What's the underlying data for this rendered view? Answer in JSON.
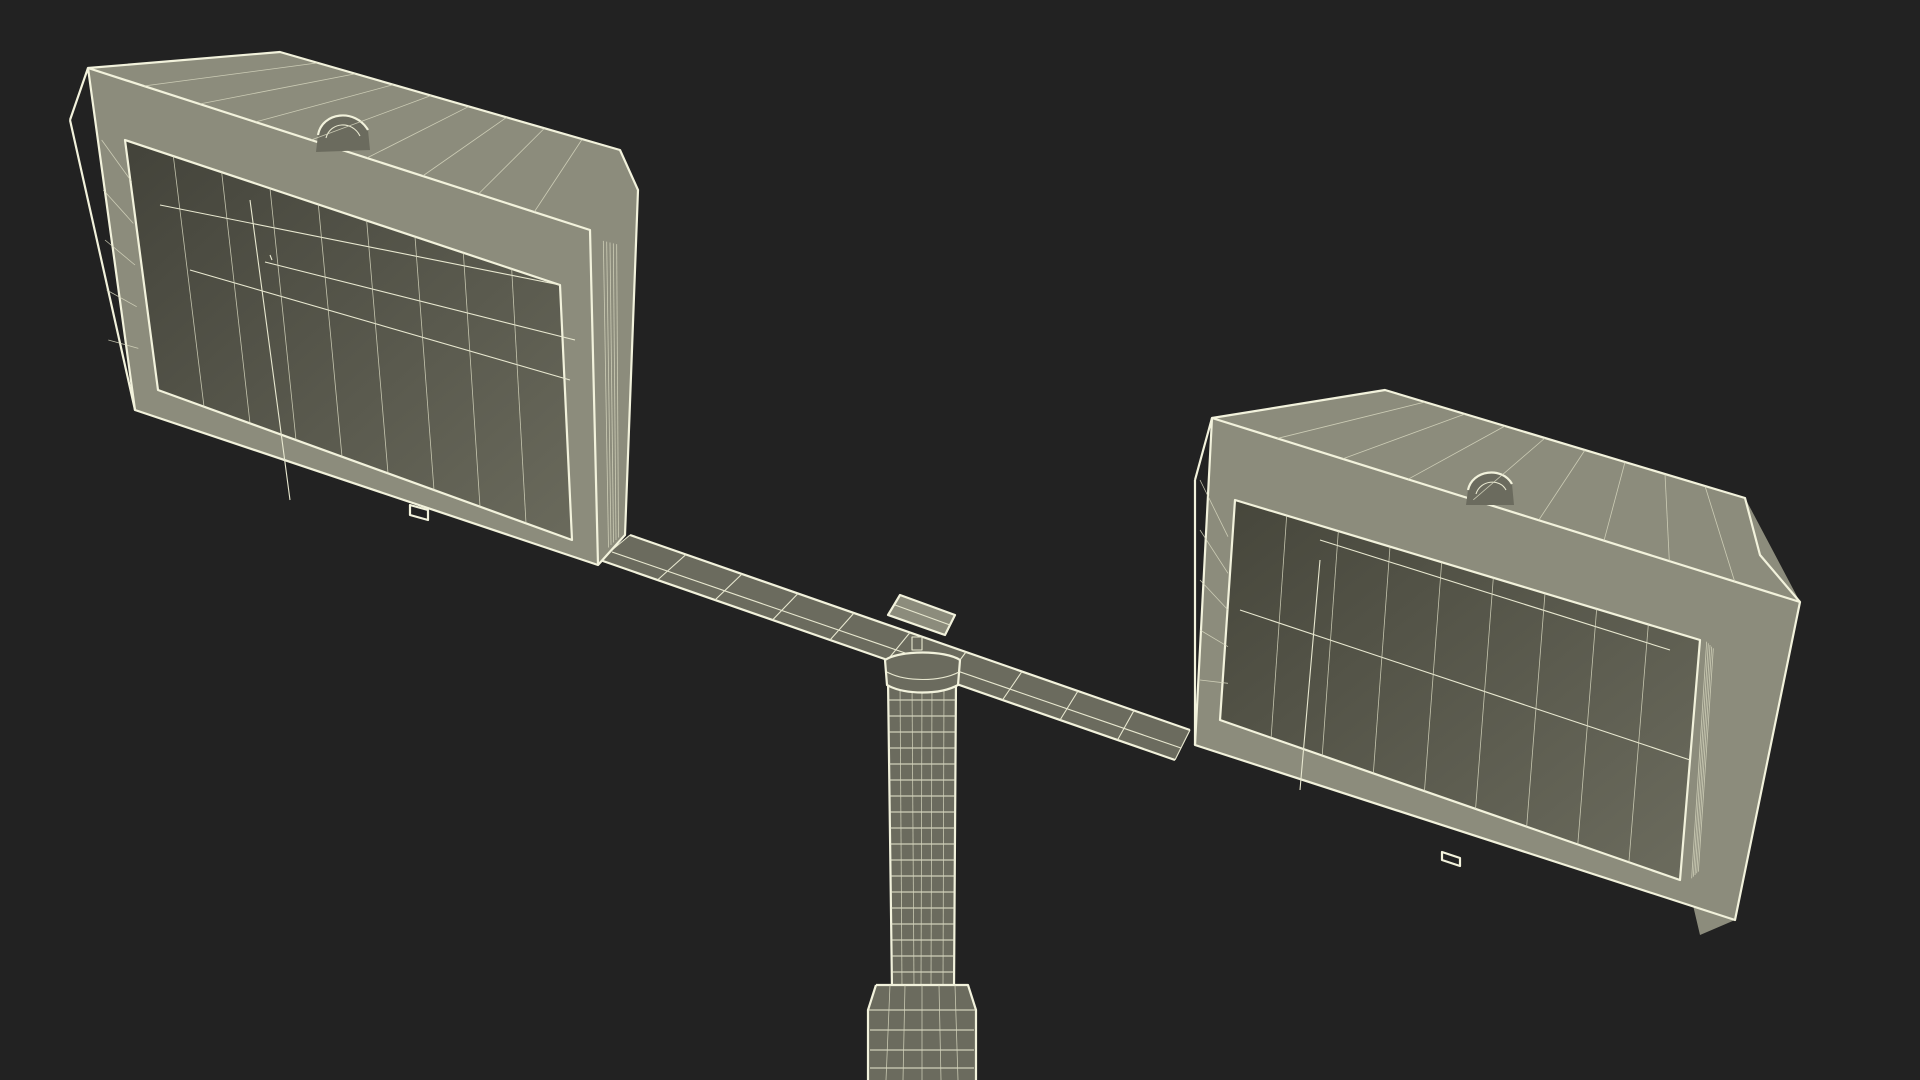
{
  "scene": {
    "background_color": "#222222",
    "wireframe_color": "#e8e8d0",
    "surface_color": "#5a5a4c",
    "objects": [
      "left-floodlight-housing",
      "right-floodlight-housing",
      "horizontal-crossbar",
      "crossbar-mount-bracket",
      "vertical-pole",
      "pole-base-collar"
    ]
  }
}
